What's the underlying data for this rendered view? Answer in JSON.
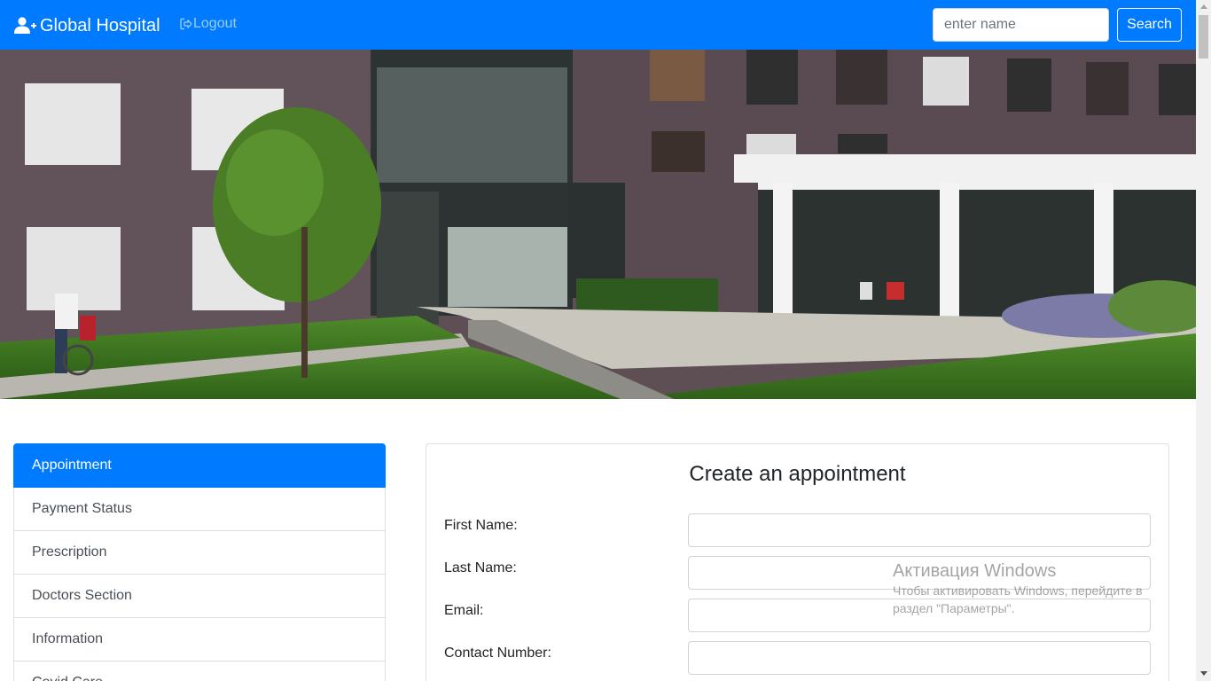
{
  "navbar": {
    "brand": "Global Hospital",
    "brand_icon": "user-plus-icon",
    "logout_label": "Logout",
    "logout_icon": "sign-out-icon",
    "search_placeholder": "enter name",
    "search_button": "Search",
    "color": "#007bff"
  },
  "sidebar": {
    "items": [
      {
        "label": "Appointment",
        "active": true
      },
      {
        "label": "Payment Status"
      },
      {
        "label": "Prescription"
      },
      {
        "label": "Doctors Section"
      },
      {
        "label": "Information"
      },
      {
        "label": "Covid Care"
      }
    ]
  },
  "form": {
    "title": "Create an appointment",
    "fields": [
      {
        "label": "First Name:",
        "value": ""
      },
      {
        "label": "Last Name:",
        "value": ""
      },
      {
        "label": "Email:",
        "value": ""
      },
      {
        "label": "Contact Number:",
        "value": ""
      }
    ]
  },
  "watermark": {
    "title": "Активация Windows",
    "line1": "Чтобы активировать Windows, перейдите в",
    "line2": "раздел \"Параметры\"."
  }
}
